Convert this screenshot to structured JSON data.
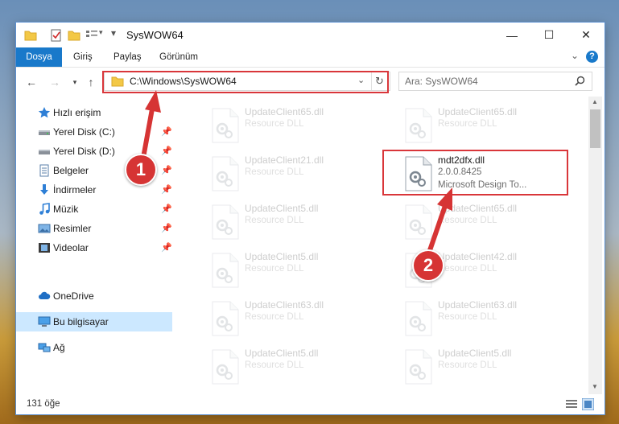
{
  "window": {
    "title": "SysWOW64",
    "controls": {
      "minimize": "—",
      "maximize": "☐",
      "close": "✕"
    }
  },
  "ribbon": {
    "tabs": [
      "Dosya",
      "Giriş",
      "Paylaş",
      "Görünüm"
    ],
    "expand": "⌄",
    "help": "?"
  },
  "address": {
    "path": "C:\\Windows\\SysWOW64",
    "search_placeholder": "Ara: SysWOW64"
  },
  "sidebar": {
    "quick_access": "Hızlı erişim",
    "items": [
      {
        "label": "Yerel Disk (C:)",
        "icon": "drive-icon"
      },
      {
        "label": "Yerel Disk (D:)",
        "icon": "drive-icon"
      },
      {
        "label": "Belgeler",
        "icon": "documents-icon"
      },
      {
        "label": "İndirmeler",
        "icon": "downloads-icon"
      },
      {
        "label": "Müzik",
        "icon": "music-icon"
      },
      {
        "label": "Resimler",
        "icon": "pictures-icon"
      },
      {
        "label": "Videolar",
        "icon": "videos-icon"
      }
    ],
    "onedrive": "OneDrive",
    "this_pc": "Bu bilgisayar",
    "network": "Ağ"
  },
  "files": {
    "faded": [
      {
        "name": "UpdateClient65.dll",
        "type": "Resource DLL"
      },
      {
        "name": "UpdateClient65.dll",
        "type": "Resource DLL"
      },
      {
        "name": "UpdateClient21.dll",
        "type": "Resource DLL"
      },
      {
        "name": "UpdateClient5.dll",
        "type": "Resource DLL"
      },
      {
        "name": "UpdateClient65.dll",
        "type": "Resource DLL"
      },
      {
        "name": "UpdateClient5.dll",
        "type": "Resource DLL"
      },
      {
        "name": "UpdateClient42.dll",
        "type": "Resource DLL"
      },
      {
        "name": "UpdateClient63.dll",
        "type": "Resource DLL"
      },
      {
        "name": "UpdateClient63.dll",
        "type": "Resource DLL"
      },
      {
        "name": "UpdateClient5.dll",
        "type": "Resource DLL"
      },
      {
        "name": "UpdateClient5.dll",
        "type": "Resource DLL"
      }
    ],
    "highlighted": {
      "name": "mdt2dfx.dll",
      "version": "2.0.0.8425",
      "description": "Microsoft Design To..."
    }
  },
  "status": {
    "count": "131 öğe"
  },
  "callouts": [
    "1",
    "2"
  ],
  "colors": {
    "accent": "#1979ca",
    "highlight": "#d9363a",
    "selection": "#cce8ff"
  }
}
